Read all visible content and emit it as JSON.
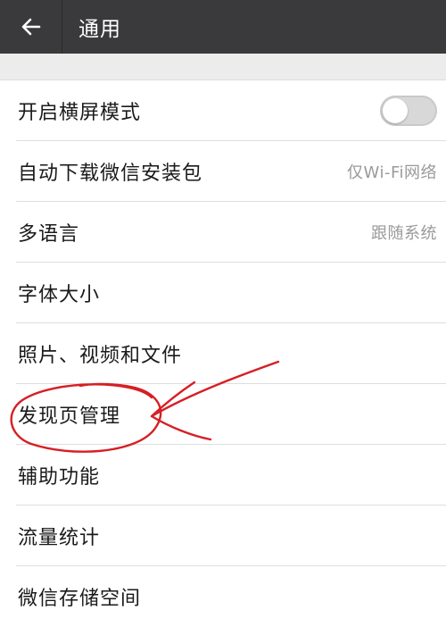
{
  "header": {
    "back_icon": "arrow-left-icon",
    "title": "通用"
  },
  "colors": {
    "header_bg": "#3a3a3c",
    "annotation_red": "#d61f24"
  },
  "settings": {
    "items": [
      {
        "label": "开启横屏模式",
        "value": "",
        "control": "toggle",
        "toggle_on": false
      },
      {
        "label": "自动下载微信安装包",
        "value": "仅Wi-Fi网络"
      },
      {
        "label": "多语言",
        "value": "跟随系统"
      },
      {
        "label": "字体大小",
        "value": ""
      },
      {
        "label": "照片、视频和文件",
        "value": ""
      },
      {
        "label": "发现页管理",
        "value": ""
      },
      {
        "label": "辅助功能",
        "value": ""
      },
      {
        "label": "流量统计",
        "value": ""
      },
      {
        "label": "微信存储空间",
        "value": ""
      }
    ]
  },
  "annotation": {
    "type": "hand-drawn-circle-and-arrow",
    "target": "发现页管理"
  }
}
